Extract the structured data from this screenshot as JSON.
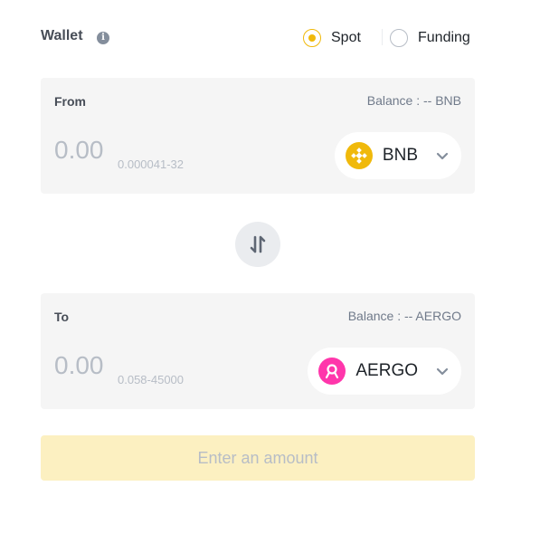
{
  "wallet": {
    "label": "Wallet",
    "info_icon": "info-icon",
    "options": [
      {
        "label": "Spot",
        "checked": true
      },
      {
        "label": "Funding",
        "checked": false
      }
    ]
  },
  "from": {
    "label": "From",
    "balance": "Balance : -- BNB",
    "amount_placeholder": "0.00",
    "range": "0.000041-32",
    "coin": {
      "symbol": "BNB",
      "icon": "bnb-coin-icon",
      "color": "#f0b90b"
    }
  },
  "swap": {
    "icon": "swap-arrows-icon"
  },
  "to": {
    "label": "To",
    "balance": "Balance : -- AERGO",
    "amount_placeholder": "0.00",
    "range": "0.058-45000",
    "coin": {
      "symbol": "AERGO",
      "icon": "aergo-coin-icon",
      "color": "#ff36ab"
    }
  },
  "submit": {
    "label": "Enter an amount"
  },
  "colors": {
    "accent": "#f0b90b",
    "panel_bg": "#f5f5f5",
    "disabled_btn": "#fcf0c1"
  }
}
